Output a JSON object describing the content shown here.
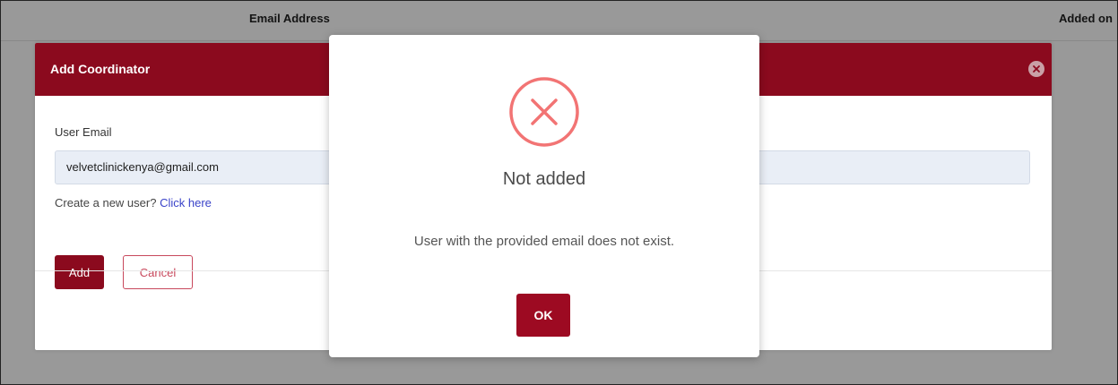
{
  "background_table": {
    "columns": [
      "Email Address",
      "Added on"
    ]
  },
  "coordinator_modal": {
    "title": "Add Coordinator",
    "email_label": "User Email",
    "email_value": "velvetclinickenya@gmail.com",
    "create_prompt": "Create a new user?",
    "create_link": "Click here",
    "add_label": "Add",
    "cancel_label": "Cancel"
  },
  "alert": {
    "icon": "error-x-icon",
    "title": "Not added",
    "message": "User with the provided email does not exist.",
    "ok_label": "OK"
  },
  "colors": {
    "brand": "#8b0a1e",
    "error": "#f27474",
    "link": "#3a43c9",
    "cancel_border": "#c8485c"
  }
}
